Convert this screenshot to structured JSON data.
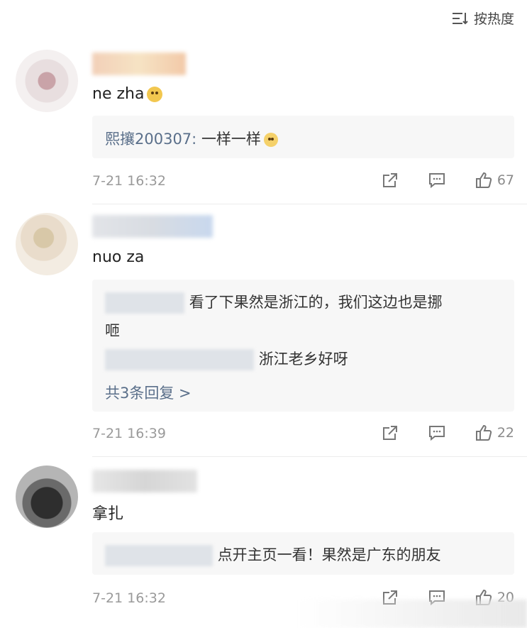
{
  "header": {
    "sort_label": "按热度"
  },
  "comments": [
    {
      "text": "ne zha",
      "emoji": "dog-emoji",
      "replies": [
        {
          "name": "熙攘200307",
          "sep": ": ",
          "text": "一样一样",
          "emoji": "laughing-emoji"
        }
      ],
      "timestamp": "7-21 16:32",
      "likes": "67"
    },
    {
      "text": "nuo za",
      "replies": [
        {
          "text": "看了下果然是浙江的，我们这边也是挪",
          "text_cont": "咂"
        },
        {
          "text": "浙江老乡好呀"
        }
      ],
      "more_replies": "共3条回复 >",
      "timestamp": "7-21 16:39",
      "likes": "22"
    },
    {
      "text": "拿扎",
      "replies": [
        {
          "text": "点开主页一看！果然是广东的朋友"
        }
      ],
      "timestamp": "7-21 16:32",
      "likes": "20"
    }
  ],
  "colors": {
    "reply_name": "#5a6f8a",
    "timestamp": "#9a9a9a",
    "reply_bg": "#f7f7f7"
  },
  "icons": [
    "sort-icon",
    "share-icon",
    "comment-icon",
    "like-icon"
  ]
}
